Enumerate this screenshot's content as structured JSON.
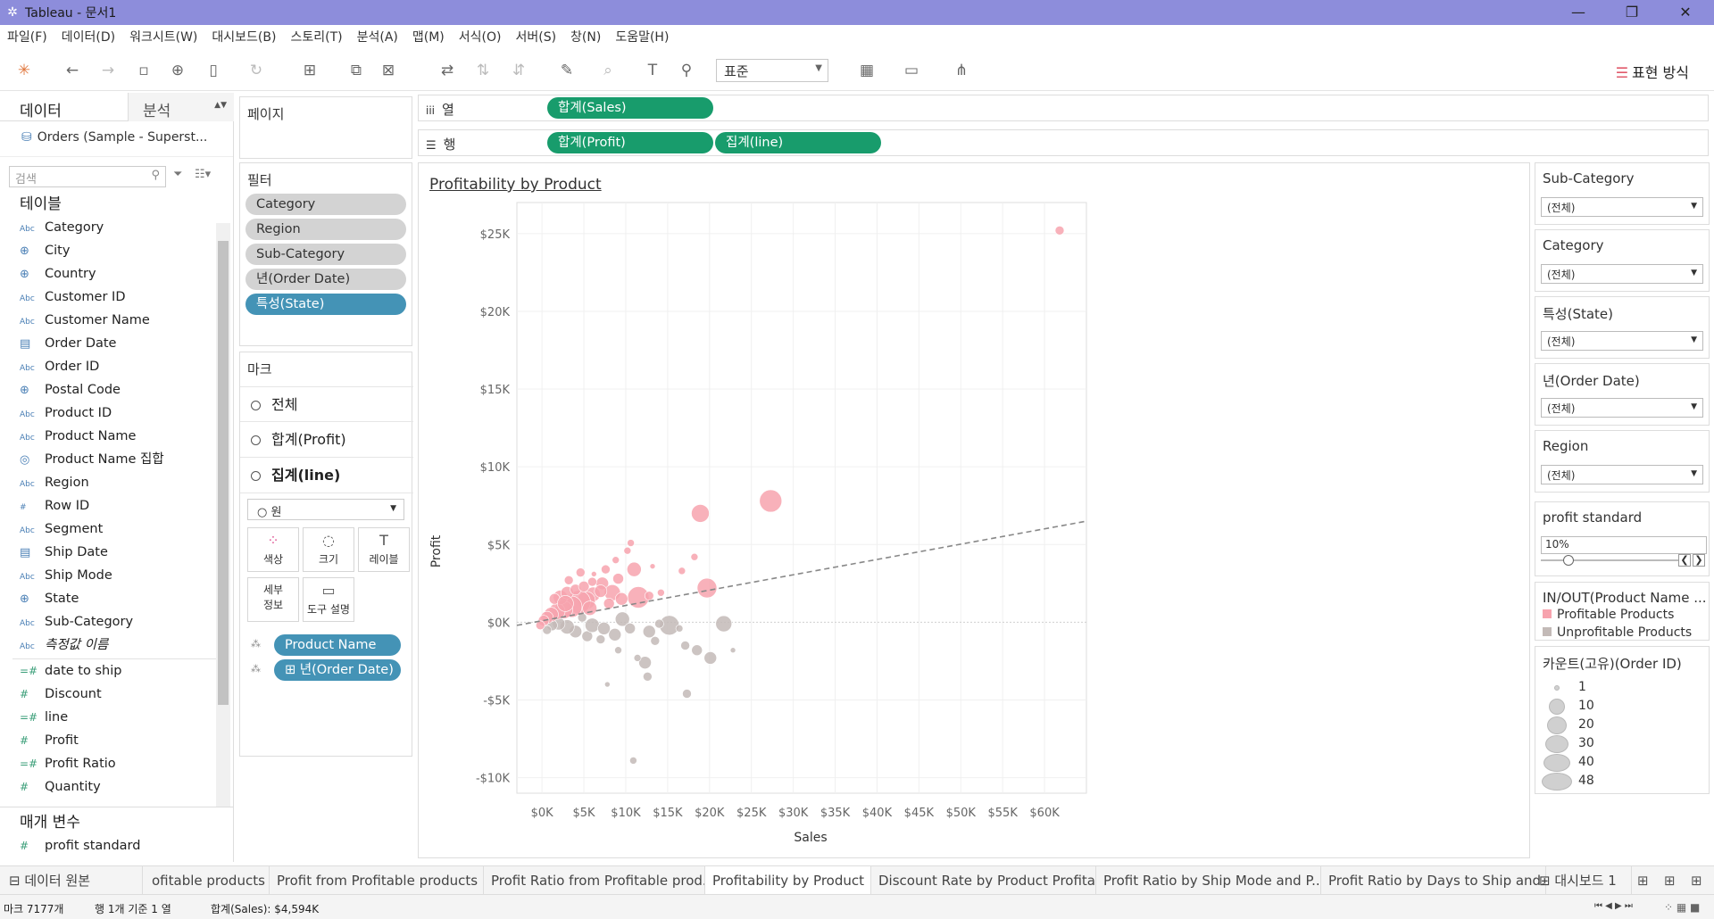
{
  "titlebar": {
    "title": "Tableau - 문서1",
    "min": "—",
    "restore": "❐",
    "close": "✕"
  },
  "menu": [
    "파일(F)",
    "데이터(D)",
    "워크시트(W)",
    "대시보드(B)",
    "스토리(T)",
    "분석(A)",
    "맵(M)",
    "서식(O)",
    "서버(S)",
    "창(N)",
    "도움말(H)"
  ],
  "toolbar": {
    "fit_value": "표준",
    "show_me": "표현 방식"
  },
  "left": {
    "tab_data": "데이터",
    "tab_analysis": "분석",
    "source": "Orders (Sample - Superst...",
    "search_placeholder": "검색",
    "tables_label": "테이블",
    "dimensions": [
      {
        "type": "Abc",
        "name": "Category"
      },
      {
        "type": "geo",
        "name": "City"
      },
      {
        "type": "geo",
        "name": "Country"
      },
      {
        "type": "Abc",
        "name": "Customer ID"
      },
      {
        "type": "Abc",
        "name": "Customer Name"
      },
      {
        "type": "date",
        "name": "Order Date"
      },
      {
        "type": "Abc",
        "name": "Order ID"
      },
      {
        "type": "geo",
        "name": "Postal Code"
      },
      {
        "type": "Abc",
        "name": "Product ID"
      },
      {
        "type": "Abc",
        "name": "Product Name"
      },
      {
        "type": "set",
        "name": "Product Name 집합"
      },
      {
        "type": "Abc",
        "name": "Region"
      },
      {
        "type": "#",
        "name": "Row ID"
      },
      {
        "type": "Abc",
        "name": "Segment"
      },
      {
        "type": "date",
        "name": "Ship Date"
      },
      {
        "type": "Abc",
        "name": "Ship Mode"
      },
      {
        "type": "geo",
        "name": "State"
      },
      {
        "type": "Abc",
        "name": "Sub-Category"
      },
      {
        "type": "Abc",
        "name": "측정값 이름"
      }
    ],
    "measures": [
      {
        "type": "calc",
        "name": "date to ship"
      },
      {
        "type": "#",
        "name": "Discount"
      },
      {
        "type": "calc",
        "name": "line"
      },
      {
        "type": "#",
        "name": "Profit"
      },
      {
        "type": "calc",
        "name": "Profit Ratio"
      },
      {
        "type": "#",
        "name": "Quantity"
      }
    ],
    "params_label": "매개 변수",
    "params": [
      {
        "type": "#",
        "name": "profit standard"
      }
    ]
  },
  "pages_label": "페이지",
  "filters": {
    "label": "필터",
    "items": [
      {
        "name": "Category",
        "style": "gray"
      },
      {
        "name": "Region",
        "style": "gray"
      },
      {
        "name": "Sub-Category",
        "style": "gray"
      },
      {
        "name": "년(Order Date)",
        "style": "gray"
      },
      {
        "name": "특성(State)",
        "style": "blue"
      }
    ]
  },
  "marks": {
    "label": "마크",
    "rows": [
      "전체",
      "합계(Profit)",
      "집계(line)"
    ],
    "type_value": "○ 원",
    "buttons": [
      {
        "label": "색상",
        "icon": "⁘"
      },
      {
        "label": "크기",
        "icon": "◌"
      },
      {
        "label": "레이블",
        "icon": "T"
      },
      {
        "label": "세부 정보",
        "icon": "⋯"
      },
      {
        "label": "도구 설명",
        "icon": "▭"
      }
    ],
    "detail_pills": [
      "Product Name",
      "⊞ 년(Order Date)"
    ]
  },
  "shelves": {
    "columns_label": "열",
    "rows_label": "행",
    "columns": [
      "합계(Sales)"
    ],
    "rows": [
      "합계(Profit)",
      "집계(line)"
    ]
  },
  "viz": {
    "title": "Profitability by Product"
  },
  "chart_data": {
    "type": "scatter",
    "xlabel": "Sales",
    "ylabel": "Profit",
    "xlim": [
      -3000,
      65000
    ],
    "ylim": [
      -11000,
      27000
    ],
    "xticks": [
      "$0K",
      "$5K",
      "$10K",
      "$15K",
      "$20K",
      "$25K",
      "$30K",
      "$35K",
      "$40K",
      "$45K",
      "$50K",
      "$55K",
      "$60K"
    ],
    "yticks": [
      "$25K",
      "$20K",
      "$15K",
      "$10K",
      "$5K",
      "$0K",
      "-$5K",
      "-$10K"
    ],
    "xtick_values": [
      0,
      5000,
      10000,
      15000,
      20000,
      25000,
      30000,
      35000,
      40000,
      45000,
      50000,
      55000,
      60000
    ],
    "ytick_values": [
      25000,
      20000,
      15000,
      10000,
      5000,
      0,
      -5000,
      -10000
    ],
    "grid": true,
    "colors": {
      "profitable": "#f7a3ae",
      "unprofitable": "#c3bab7",
      "trend": "#888888"
    },
    "trend_line": [
      [
        -4000,
        -300
      ],
      [
        65000,
        6500
      ]
    ],
    "series": [
      {
        "name": "Profitable Products",
        "points": [
          [
            61800,
            25200,
            10
          ],
          [
            27300,
            7800,
            25
          ],
          [
            18900,
            7000,
            20
          ],
          [
            19700,
            2200,
            22
          ],
          [
            11000,
            3400,
            16
          ],
          [
            11500,
            1600,
            24
          ],
          [
            10200,
            4600,
            8
          ],
          [
            8800,
            4000,
            8
          ],
          [
            7600,
            3400,
            10
          ],
          [
            6200,
            3100,
            6
          ],
          [
            7200,
            2500,
            14
          ],
          [
            9100,
            2800,
            12
          ],
          [
            8400,
            1900,
            18
          ],
          [
            6100,
            1800,
            16
          ],
          [
            5300,
            1400,
            20
          ],
          [
            4400,
            1300,
            26
          ],
          [
            3500,
            1000,
            24
          ],
          [
            2600,
            800,
            20
          ],
          [
            1800,
            700,
            18
          ],
          [
            1100,
            500,
            16
          ],
          [
            600,
            300,
            14
          ],
          [
            200,
            100,
            12
          ],
          [
            -200,
            -200,
            10
          ],
          [
            2200,
            1600,
            16
          ],
          [
            3000,
            1900,
            14
          ],
          [
            4000,
            2100,
            12
          ],
          [
            5000,
            2300,
            12
          ],
          [
            6000,
            2600,
            10
          ],
          [
            7000,
            2000,
            14
          ],
          [
            8000,
            1200,
            12
          ],
          [
            9500,
            1500,
            14
          ],
          [
            12800,
            1700,
            10
          ],
          [
            14200,
            1900,
            8
          ],
          [
            13200,
            3600,
            6
          ],
          [
            16700,
            3300,
            8
          ],
          [
            18200,
            4200,
            8
          ],
          [
            10600,
            5100,
            8
          ],
          [
            3200,
            2700,
            10
          ],
          [
            4600,
            3200,
            10
          ],
          [
            1500,
            1500,
            12
          ],
          [
            2800,
            1200,
            18
          ],
          [
            5700,
            900,
            16
          ]
        ]
      },
      {
        "name": "Unprofitable Products",
        "points": [
          [
            8700,
            -800,
            14
          ],
          [
            9600,
            200,
            16
          ],
          [
            10500,
            -400,
            12
          ],
          [
            12800,
            -600,
            14
          ],
          [
            15200,
            -200,
            22
          ],
          [
            18500,
            -1800,
            12
          ],
          [
            21700,
            -100,
            18
          ],
          [
            17100,
            -1500,
            10
          ],
          [
            16400,
            -400,
            8
          ],
          [
            13500,
            -1200,
            10
          ],
          [
            12300,
            -2600,
            14
          ],
          [
            12600,
            -3500,
            10
          ],
          [
            17300,
            -4600,
            10
          ],
          [
            10900,
            -8900,
            8
          ],
          [
            7800,
            -4000,
            6
          ],
          [
            7000,
            -1100,
            10
          ],
          [
            5400,
            -900,
            12
          ],
          [
            4000,
            -600,
            14
          ],
          [
            3000,
            -300,
            16
          ],
          [
            2000,
            -100,
            14
          ],
          [
            1200,
            -200,
            12
          ],
          [
            600,
            -500,
            10
          ],
          [
            6000,
            -200,
            16
          ],
          [
            7400,
            -400,
            14
          ],
          [
            20100,
            -2300,
            14
          ],
          [
            22800,
            -1800,
            6
          ],
          [
            4800,
            300,
            10
          ],
          [
            9100,
            -1800,
            8
          ],
          [
            11400,
            -2300,
            8
          ],
          [
            14000,
            -100,
            10
          ]
        ]
      }
    ]
  },
  "right": {
    "filters": [
      {
        "title": "Sub-Category",
        "value": "(전체)"
      },
      {
        "title": "Category",
        "value": "(전체)"
      },
      {
        "title": "특성(State)",
        "value": "(전체)"
      },
      {
        "title": "년(Order Date)",
        "value": "(전체)"
      },
      {
        "title": "Region",
        "value": "(전체)"
      }
    ],
    "param_title": "profit standard",
    "param_value": "10%",
    "param_fraction": 0.1,
    "color_legend_title": "IN/OUT(Product Name ...",
    "color_legend": [
      {
        "label": "Profitable Products",
        "color": "#f7a3ae"
      },
      {
        "label": "Unprofitable Products",
        "color": "#c3bab7"
      }
    ],
    "size_legend_title": "카운트(고유)(Order ID)",
    "size_legend": [
      "1",
      "10",
      "20",
      "30",
      "40",
      "48"
    ]
  },
  "sheet_tabs": {
    "datasource": "⊟ 데이터 원본",
    "tabs": [
      "ofitable products",
      "Profit from Profitable products",
      "Profit Ratio from Profitable prod...",
      "Profitability by Product",
      "Discount Rate by Product Profita...",
      "Profit Ratio by Ship Mode and P...",
      "Profit Ratio by Days to Ship and..."
    ],
    "active_index": 3,
    "dashboard": "⊞ 대시보드 1"
  },
  "status": {
    "marks": "마크 7177개",
    "rows": "행 1개 기준 1 열",
    "sum": "합계(Sales): $4,594K"
  }
}
